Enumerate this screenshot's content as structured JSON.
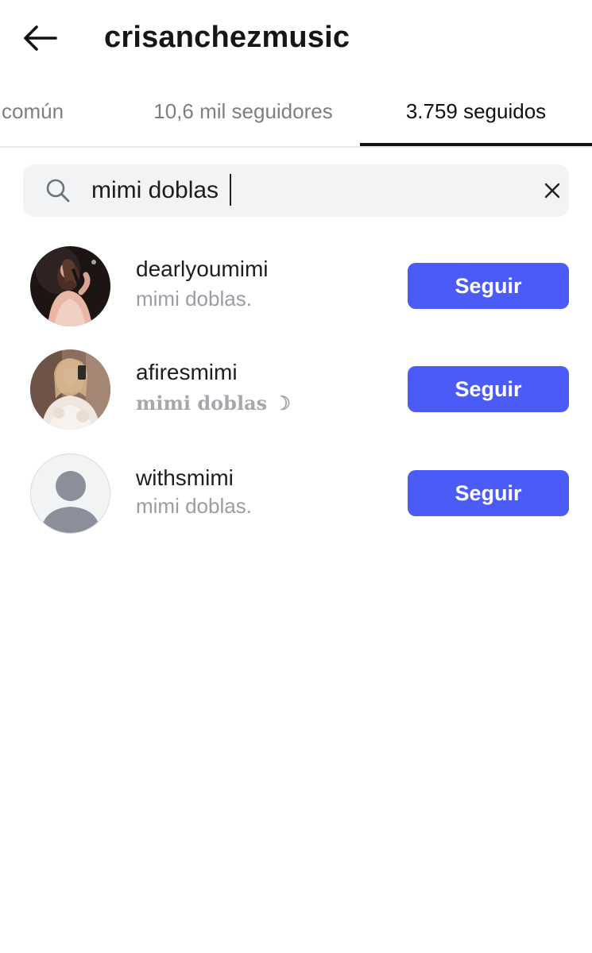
{
  "header": {
    "title": "crisanchezmusic",
    "back_icon": "arrow-left-icon"
  },
  "tabs": [
    {
      "label": "común",
      "active": false
    },
    {
      "label": "10,6 mil seguidores",
      "active": false
    },
    {
      "label": "3.759 seguidos",
      "active": true
    }
  ],
  "search": {
    "value": "mimi doblas",
    "icon": "search-icon",
    "clear_icon": "close-icon"
  },
  "results": [
    {
      "username": "dearlyoumimi",
      "display_name": "mimi doblas.",
      "button": "Seguir",
      "avatar": "photo"
    },
    {
      "username": "afiresmimi",
      "display_name": "mimi doblas ☽",
      "button": "Seguir",
      "avatar": "photo"
    },
    {
      "username": "withsmimi",
      "display_name": "mimi doblas.",
      "button": "Seguir",
      "avatar": "default-person-icon"
    }
  ],
  "colors": {
    "accent": "#4a5bf7",
    "search_bg": "#f2f3f5",
    "tab_divider": "#e4e8ec"
  }
}
